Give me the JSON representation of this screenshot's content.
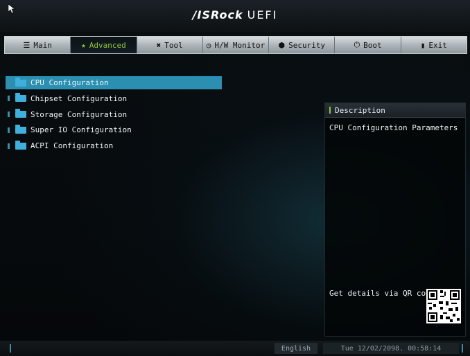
{
  "header": {
    "brand": "/ISRock",
    "product": "UEFI"
  },
  "tabs": [
    {
      "label": "Main",
      "icon": "list-icon",
      "glyph": "☰"
    },
    {
      "label": "Advanced",
      "icon": "star-icon",
      "glyph": "★"
    },
    {
      "label": "Tool",
      "icon": "tools-icon",
      "glyph": "✖"
    },
    {
      "label": "H/W Monitor",
      "icon": "monitor-icon",
      "glyph": "◷"
    },
    {
      "label": "Security",
      "icon": "shield-icon",
      "glyph": "⬢"
    },
    {
      "label": "Boot",
      "icon": "power-icon",
      "glyph": "⏻"
    },
    {
      "label": "Exit",
      "icon": "exit-icon",
      "glyph": "▮"
    }
  ],
  "active_tab": "Advanced",
  "menu": {
    "items": [
      {
        "label": "CPU Configuration"
      },
      {
        "label": "Chipset Configuration"
      },
      {
        "label": "Storage Configuration"
      },
      {
        "label": "Super IO Configuration"
      },
      {
        "label": "ACPI Configuration"
      }
    ],
    "selected_index": 0
  },
  "description": {
    "title": "Description",
    "text": "CPU Configuration Parameters",
    "qr_label": "Get details via QR code"
  },
  "footer": {
    "language": "English",
    "datetime": "Tue 12/02/2098. 00:58:14"
  },
  "colors": {
    "accent_green": "#8fc73e",
    "selection_blue": "#2a8fb0",
    "folder_blue": "#3fb0dc"
  }
}
